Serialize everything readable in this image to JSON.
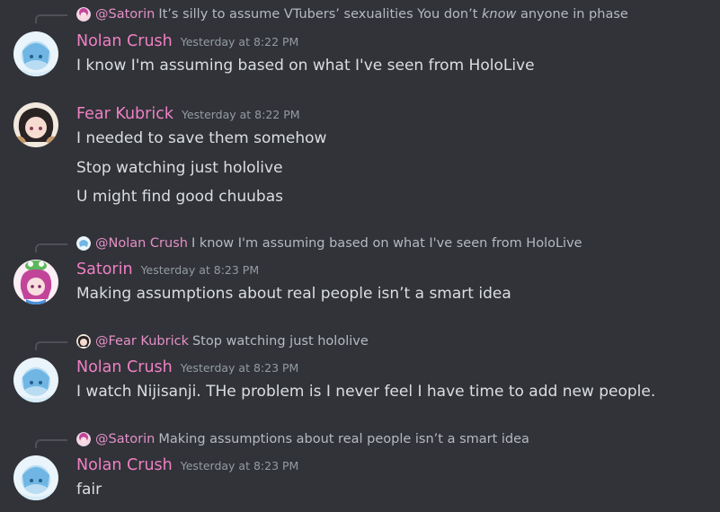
{
  "colors": {
    "background": "#313338",
    "username": "#ef80c4",
    "mention": "#e590c8",
    "text": "#dbdee1",
    "muted": "#b5bac1",
    "timestamp": "#949ba4"
  },
  "messages": [
    {
      "reply": {
        "avatar_icon": "satorin-avatar-mini",
        "mention": "@Satorin",
        "text_before": "It’s silly to assume VTubers’ sexualities You don’t ",
        "text_em": "know",
        "text_after": " anyone in phase"
      },
      "author": "Nolan Crush",
      "avatar_icon": "nolan-avatar",
      "timestamp": "Yesterday at 8:22 PM",
      "lines": [
        "I know I'm assuming based on what I've seen from HoloLive"
      ]
    },
    {
      "author": "Fear Kubrick",
      "avatar_icon": "fear-avatar",
      "timestamp": "Yesterday at 8:22 PM",
      "lines": [
        "I needed to save them somehow",
        "Stop watching just hololive",
        "U might find good chuubas"
      ]
    },
    {
      "reply": {
        "avatar_icon": "nolan-avatar-mini",
        "mention": "@Nolan Crush",
        "text": "I know I'm assuming based on what I've seen from HoloLive"
      },
      "author": "Satorin",
      "avatar_icon": "satorin-avatar",
      "timestamp": "Yesterday at 8:23 PM",
      "lines": [
        "Making assumptions about real people isn’t a smart idea"
      ]
    },
    {
      "reply": {
        "avatar_icon": "fear-avatar-mini",
        "mention": "@Fear Kubrick",
        "text": "Stop watching just hololive"
      },
      "author": "Nolan Crush",
      "avatar_icon": "nolan-avatar",
      "timestamp": "Yesterday at 8:23 PM",
      "lines": [
        "I watch Nijisanji. THe problem is I never feel I have time to add new people."
      ]
    },
    {
      "reply": {
        "avatar_icon": "satorin-avatar-mini",
        "mention": "@Satorin",
        "text": "Making assumptions about real people isn’t a smart idea"
      },
      "author": "Nolan Crush",
      "avatar_icon": "nolan-avatar",
      "timestamp": "Yesterday at 8:23 PM",
      "lines": [
        "fair"
      ]
    }
  ]
}
